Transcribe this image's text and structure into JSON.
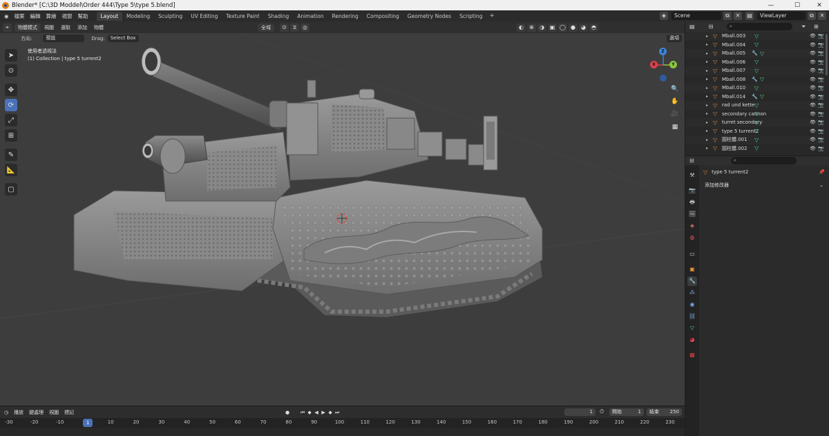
{
  "window": {
    "title": "Blender* [C:\\3D Moddel\\Order 444\\Type 5\\type 5.blend]",
    "minimize": "—",
    "maximize": "☐",
    "close": "✕"
  },
  "menus": [
    "檔案",
    "編輯",
    "算繪",
    "視窗",
    "幫助"
  ],
  "workspaces": [
    {
      "label": "Layout",
      "active": true
    },
    {
      "label": "Modeling",
      "active": false
    },
    {
      "label": "Sculpting",
      "active": false
    },
    {
      "label": "UV Editing",
      "active": false
    },
    {
      "label": "Texture Paint",
      "active": false
    },
    {
      "label": "Shading",
      "active": false
    },
    {
      "label": "Animation",
      "active": false
    },
    {
      "label": "Rendering",
      "active": false
    },
    {
      "label": "Compositing",
      "active": false
    },
    {
      "label": "Geometry Nodes",
      "active": false
    },
    {
      "label": "Scripting",
      "active": false
    }
  ],
  "add_workspace": "+",
  "scene": {
    "name": "Scene",
    "view_layer": "ViewLayer"
  },
  "viewport": {
    "mode": "物體模式",
    "menus": [
      "視圖",
      "選取",
      "添加",
      "物體"
    ],
    "transform_space": "全域",
    "orientation_label": "方向:",
    "orientation_value": "預設",
    "drag_label": "Drag:",
    "drag_value": "Select Box",
    "options": "選項",
    "view_name": "使用者透視法",
    "collection_info": "(1) Collection | type 5 turrent2",
    "gizmo": {
      "z": "Z",
      "y": "Y",
      "x": "X"
    }
  },
  "outliner": {
    "search_placeholder": "",
    "rows": [
      {
        "name": "Mball.003",
        "mod": false
      },
      {
        "name": "Mball.004",
        "mod": false
      },
      {
        "name": "Mball.005",
        "mod": true
      },
      {
        "name": "Mball.006",
        "mod": false
      },
      {
        "name": "Mball.007",
        "mod": false
      },
      {
        "name": "Mball.008",
        "mod": true
      },
      {
        "name": "Mball.010",
        "mod": false
      },
      {
        "name": "Mball.014",
        "mod": true
      },
      {
        "name": "rad und kette",
        "mod": false
      },
      {
        "name": "secondary cannon",
        "mod": false
      },
      {
        "name": "turret secondary",
        "mod": false
      },
      {
        "name": "type 5 turrent2",
        "mod": false
      },
      {
        "name": "圓柱體.001",
        "mod": false
      },
      {
        "name": "圓柱體.002",
        "mod": false
      }
    ]
  },
  "properties": {
    "object_name": "type 5 turrent2",
    "add_modifier": "添加修改器"
  },
  "timeline": {
    "menus": [
      "播放",
      "鍵處理",
      "視圖",
      "標記"
    ],
    "current_frame": "1",
    "start_label": "開始",
    "start": "1",
    "end_label": "結束",
    "end": "250",
    "ticks": [
      "-30",
      "-20",
      "-10",
      "1",
      "10",
      "20",
      "30",
      "40",
      "50",
      "60",
      "70",
      "80",
      "90",
      "100",
      "110",
      "120",
      "130",
      "140",
      "150",
      "160",
      "170",
      "180",
      "190",
      "200",
      "210",
      "220",
      "230"
    ]
  },
  "colors": {
    "accent": "#4a72b8",
    "viewport_bg": "#3d3d3d",
    "object_orange": "#e08a3c",
    "mesh_green": "#4bd18b",
    "axis_x": "#e0414d",
    "axis_y": "#8cc63f",
    "axis_z": "#3d85d9"
  }
}
